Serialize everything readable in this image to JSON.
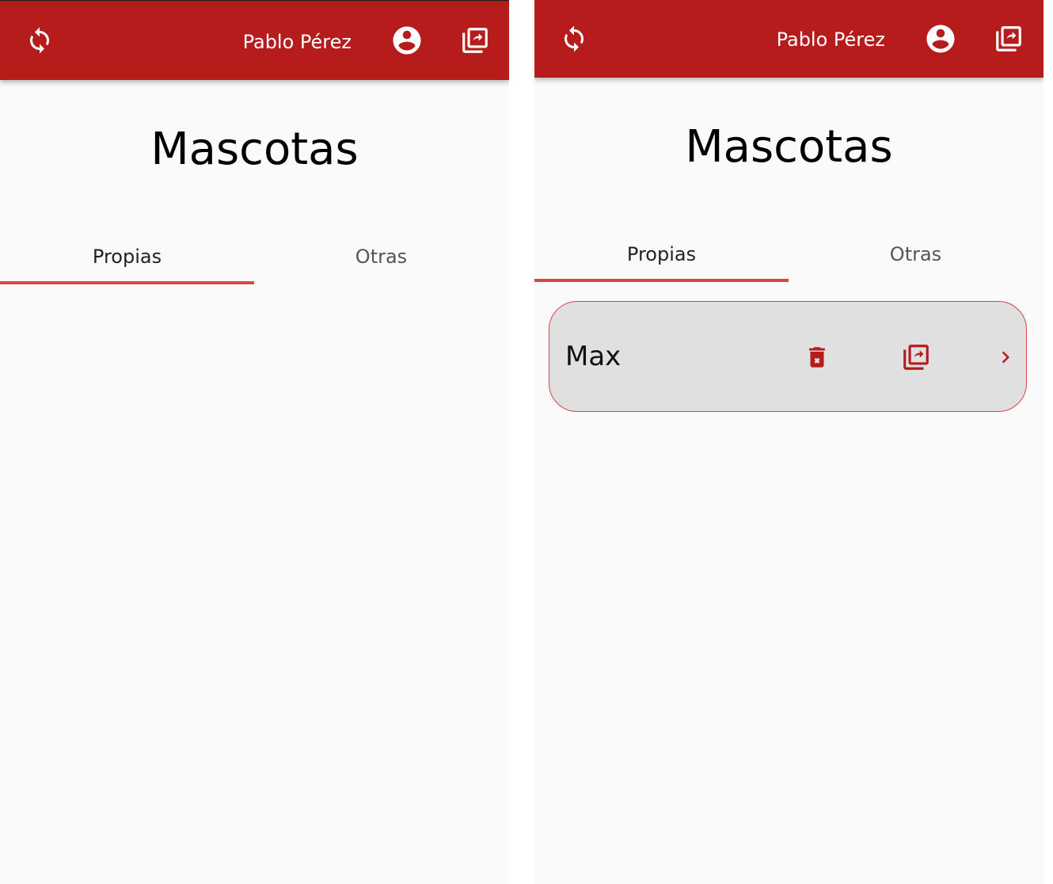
{
  "colors": {
    "appbar": "#b71c1c",
    "accent": "#d9463b",
    "background": "#fafafa",
    "card_background": "#e0e0e0",
    "icon_red": "#b71c1c"
  },
  "screens": [
    {
      "appbar": {
        "user_name": "Pablo Pérez",
        "icons": [
          "sync-icon",
          "account-circle-icon",
          "shared-documents-icon"
        ]
      },
      "title": "Mascotas",
      "tabs": [
        {
          "label": "Propias",
          "active": true
        },
        {
          "label": "Otras",
          "active": false
        }
      ],
      "pets": []
    },
    {
      "appbar": {
        "user_name": "Pablo Pérez",
        "icons": [
          "sync-icon",
          "account-circle-icon",
          "shared-documents-icon"
        ]
      },
      "title": "Mascotas",
      "tabs": [
        {
          "label": "Propias",
          "active": true
        },
        {
          "label": "Otras",
          "active": false
        }
      ],
      "pets": [
        {
          "name": "Max",
          "icons": [
            "delete-icon",
            "shared-documents-icon",
            "chevron-right-icon"
          ]
        }
      ]
    }
  ]
}
